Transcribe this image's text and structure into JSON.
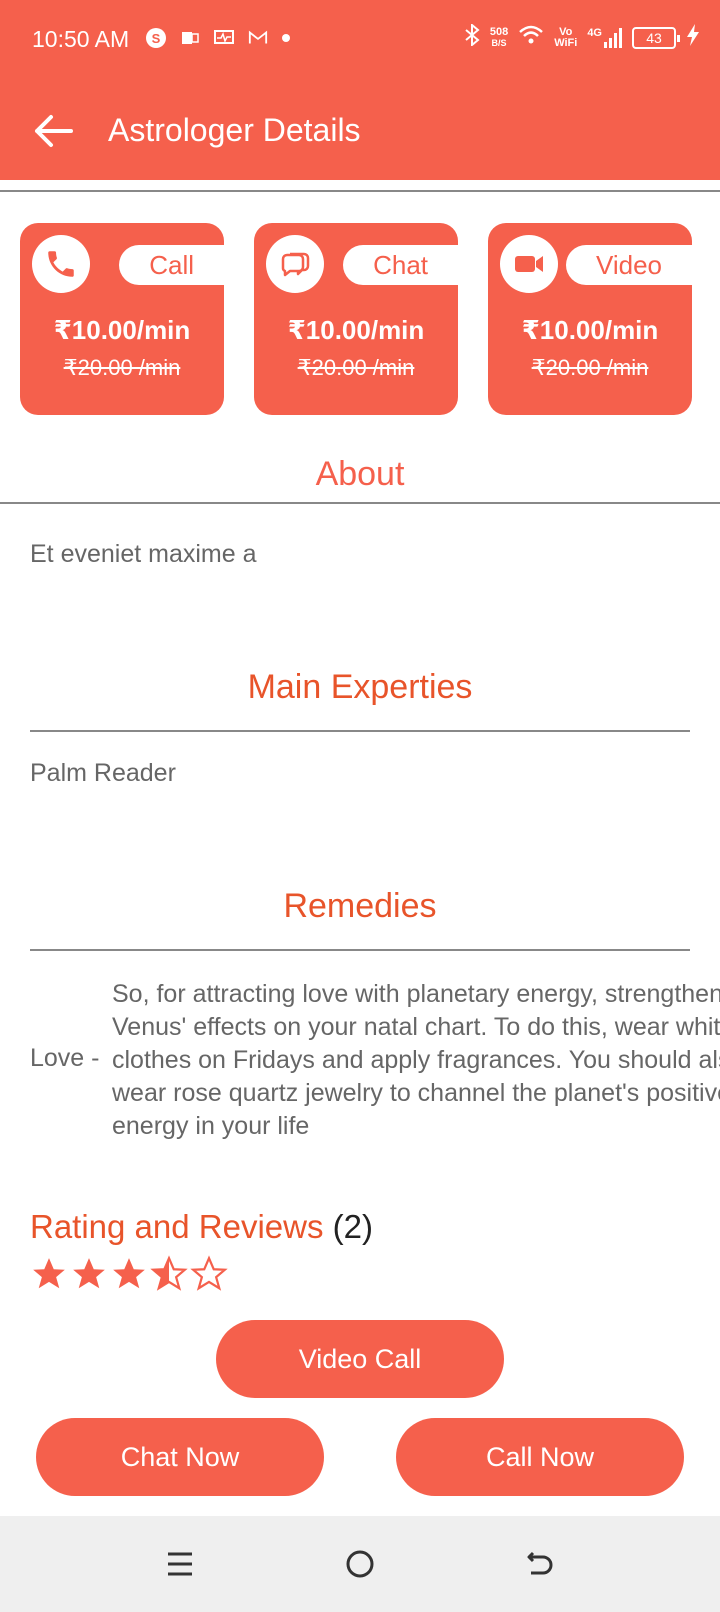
{
  "status_bar": {
    "time": "10:50 AM",
    "speed_value": "508",
    "speed_unit": "B/S",
    "wifi_label_top": "Vo",
    "wifi_label_bottom": "WiFi",
    "network": "4G",
    "battery": "43"
  },
  "header": {
    "title": "Astrologer Details"
  },
  "services": [
    {
      "label": "Call",
      "price": "₹10.00/min",
      "old_price": "₹20.00 /min",
      "icon": "phone-icon"
    },
    {
      "label": "Chat",
      "price": "₹10.00/min",
      "old_price": "₹20.00 /min",
      "icon": "chat-bubble-icon"
    },
    {
      "label": "Video",
      "price": "₹10.00/min",
      "old_price": "₹20.00 /min",
      "icon": "video-camera-icon"
    }
  ],
  "about": {
    "title": "About",
    "text": "Et eveniet maxime a"
  },
  "expertise": {
    "title": "Main Experties",
    "text": "Palm Reader"
  },
  "remedies": {
    "title": "Remedies",
    "key": "Love -",
    "text": "So, for attracting love with planetary energy, strengthen Venus' effects on your natal chart. To do this, wear white clothes on Fridays and apply fragrances. You should also wear rose quartz jewelry to channel the planet's positive energy in your life"
  },
  "rating": {
    "label": "Rating and Reviews",
    "count": "(2)",
    "stars": 3.5,
    "max_stars": 5
  },
  "actions": {
    "video_call": "Video Call",
    "chat_now": "Chat Now",
    "call_now": "Call Now"
  },
  "colors": {
    "accent": "#f5604c",
    "heading": "#e8542a",
    "nav_bg": "#efefef"
  }
}
